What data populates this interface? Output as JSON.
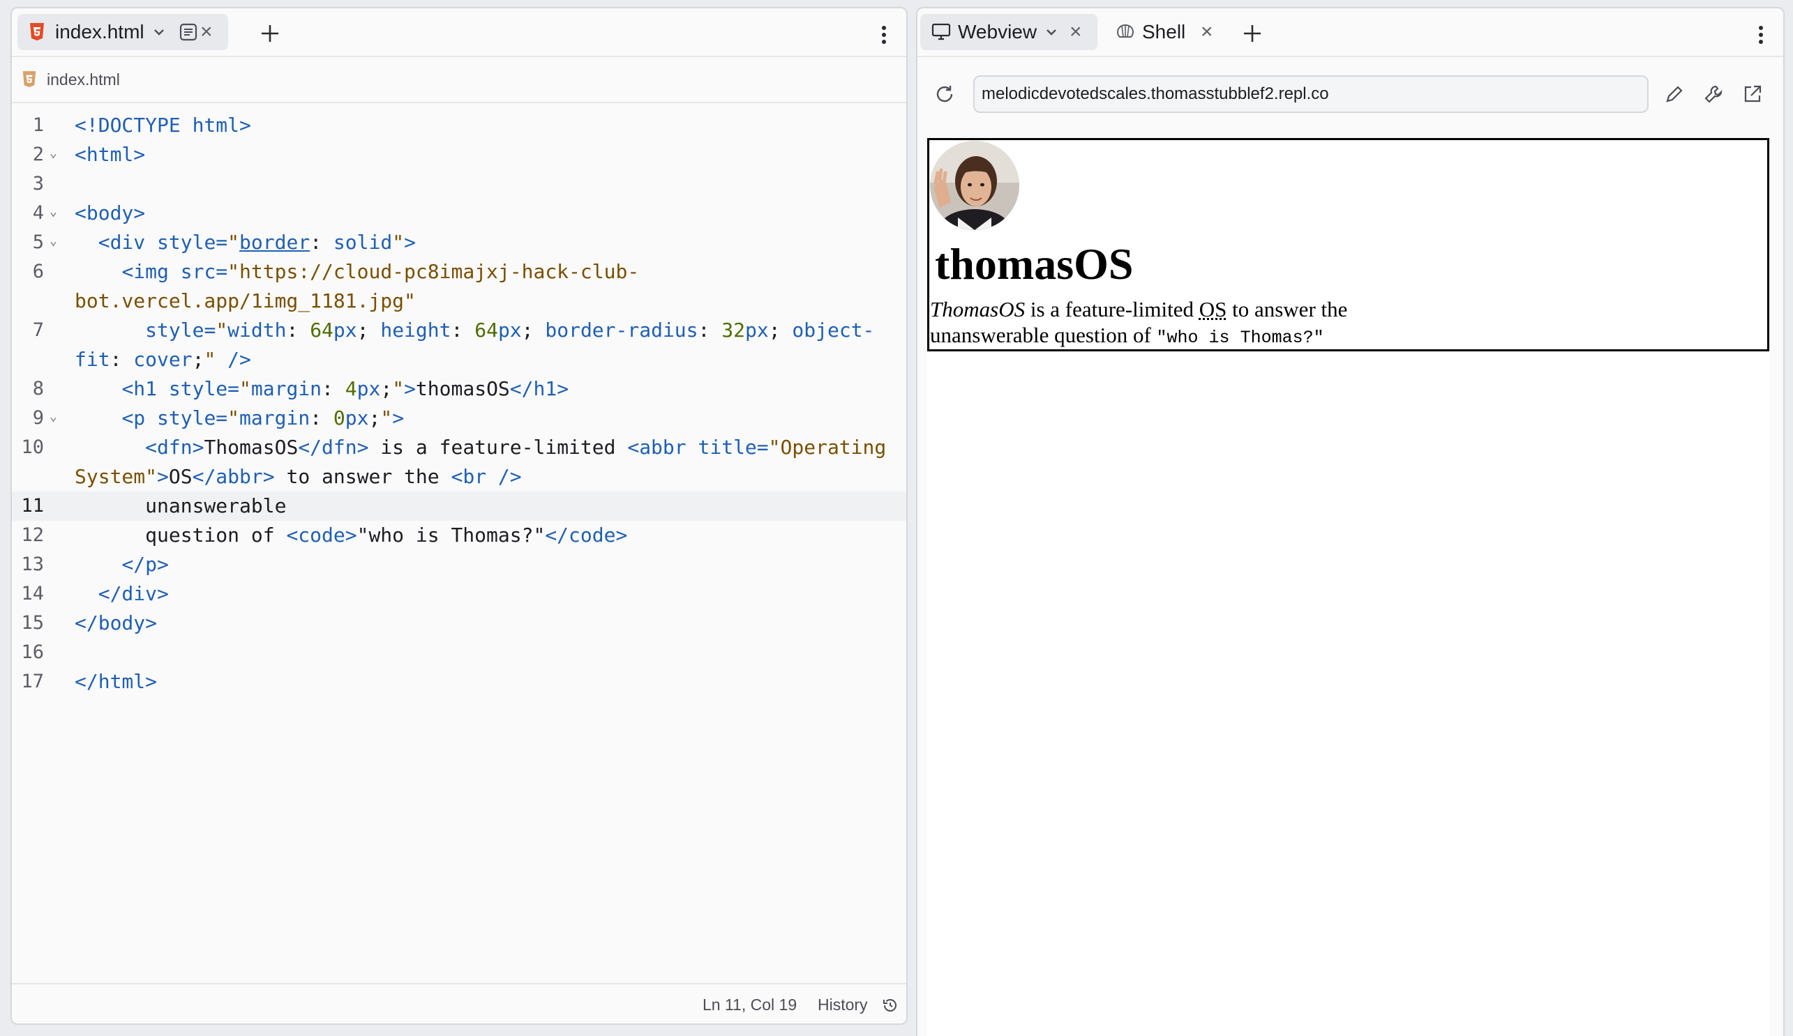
{
  "editor": {
    "tab_label": "index.html",
    "breadcrumb": "index.html",
    "lines": [
      {
        "num": "1",
        "fold": ""
      },
      {
        "num": "2",
        "fold": "⌄"
      },
      {
        "num": "3",
        "fold": ""
      },
      {
        "num": "4",
        "fold": "⌄"
      },
      {
        "num": "5",
        "fold": "⌄"
      },
      {
        "num": "6",
        "fold": ""
      },
      {
        "num": "",
        "fold": ""
      },
      {
        "num": "7",
        "fold": ""
      },
      {
        "num": "",
        "fold": ""
      },
      {
        "num": "8",
        "fold": ""
      },
      {
        "num": "9",
        "fold": "⌄"
      },
      {
        "num": "10",
        "fold": ""
      },
      {
        "num": "",
        "fold": ""
      },
      {
        "num": "11",
        "fold": ""
      },
      {
        "num": "12",
        "fold": ""
      },
      {
        "num": "13",
        "fold": ""
      },
      {
        "num": "14",
        "fold": ""
      },
      {
        "num": "15",
        "fold": ""
      },
      {
        "num": "16",
        "fold": ""
      },
      {
        "num": "17",
        "fold": ""
      }
    ],
    "current_line": "11",
    "code": [
      [
        {
          "t": "tag",
          "s": "<!DOCTYPE html>"
        }
      ],
      [
        {
          "t": "tag",
          "s": "<html>"
        }
      ],
      [],
      [
        {
          "t": "tag",
          "s": "<body>"
        }
      ],
      [
        {
          "t": "plain",
          "s": "  "
        },
        {
          "t": "tag",
          "s": "<div "
        },
        {
          "t": "attr",
          "s": "style="
        },
        {
          "t": "str",
          "s": "\""
        },
        {
          "t": "attr u",
          "s": "border"
        },
        {
          "t": "plain",
          "s": ": "
        },
        {
          "t": "attr",
          "s": "solid"
        },
        {
          "t": "str",
          "s": "\""
        },
        {
          "t": "tag",
          "s": ">"
        }
      ],
      [
        {
          "t": "plain",
          "s": "    "
        },
        {
          "t": "tag",
          "s": "<img "
        },
        {
          "t": "attr",
          "s": "src="
        },
        {
          "t": "str",
          "s": "\"https://cloud-pc8imajxj-hack-club-"
        }
      ],
      [
        {
          "t": "str",
          "s": "bot.vercel.app/1img_1181.jpg\""
        }
      ],
      [
        {
          "t": "plain",
          "s": "      "
        },
        {
          "t": "attr",
          "s": "style="
        },
        {
          "t": "str",
          "s": "\""
        },
        {
          "t": "attr",
          "s": "width"
        },
        {
          "t": "plain",
          "s": ": "
        },
        {
          "t": "num",
          "s": "64"
        },
        {
          "t": "attr",
          "s": "px"
        },
        {
          "t": "plain",
          "s": "; "
        },
        {
          "t": "attr",
          "s": "height"
        },
        {
          "t": "plain",
          "s": ": "
        },
        {
          "t": "num",
          "s": "64"
        },
        {
          "t": "attr",
          "s": "px"
        },
        {
          "t": "plain",
          "s": "; "
        },
        {
          "t": "attr",
          "s": "border-radius"
        },
        {
          "t": "plain",
          "s": ": "
        },
        {
          "t": "num",
          "s": "32"
        },
        {
          "t": "attr",
          "s": "px"
        },
        {
          "t": "plain",
          "s": "; "
        },
        {
          "t": "attr",
          "s": "object-"
        }
      ],
      [
        {
          "t": "attr",
          "s": "fit"
        },
        {
          "t": "plain",
          "s": ": "
        },
        {
          "t": "attr",
          "s": "cover"
        },
        {
          "t": "plain",
          "s": ";"
        },
        {
          "t": "str",
          "s": "\""
        },
        {
          "t": "tag",
          "s": " />"
        }
      ],
      [
        {
          "t": "plain",
          "s": "    "
        },
        {
          "t": "tag",
          "s": "<h1 "
        },
        {
          "t": "attr",
          "s": "style="
        },
        {
          "t": "str",
          "s": "\""
        },
        {
          "t": "attr",
          "s": "margin"
        },
        {
          "t": "plain",
          "s": ": "
        },
        {
          "t": "num",
          "s": "4"
        },
        {
          "t": "attr",
          "s": "px"
        },
        {
          "t": "plain",
          "s": ";"
        },
        {
          "t": "str",
          "s": "\""
        },
        {
          "t": "tag",
          "s": ">"
        },
        {
          "t": "plain",
          "s": "thomasOS"
        },
        {
          "t": "tag",
          "s": "</h1>"
        }
      ],
      [
        {
          "t": "plain",
          "s": "    "
        },
        {
          "t": "tag",
          "s": "<p "
        },
        {
          "t": "attr",
          "s": "style="
        },
        {
          "t": "str",
          "s": "\""
        },
        {
          "t": "attr",
          "s": "margin"
        },
        {
          "t": "plain",
          "s": ": "
        },
        {
          "t": "num",
          "s": "0"
        },
        {
          "t": "attr",
          "s": "px"
        },
        {
          "t": "plain",
          "s": ";"
        },
        {
          "t": "str",
          "s": "\""
        },
        {
          "t": "tag",
          "s": ">"
        }
      ],
      [
        {
          "t": "plain",
          "s": "      "
        },
        {
          "t": "tag",
          "s": "<dfn>"
        },
        {
          "t": "plain",
          "s": "ThomasOS"
        },
        {
          "t": "tag",
          "s": "</dfn>"
        },
        {
          "t": "plain",
          "s": " is a feature-limited "
        },
        {
          "t": "tag",
          "s": "<abbr "
        },
        {
          "t": "attr",
          "s": "title="
        },
        {
          "t": "str",
          "s": "\"Operating"
        }
      ],
      [
        {
          "t": "str",
          "s": "System\""
        },
        {
          "t": "tag",
          "s": ">"
        },
        {
          "t": "plain",
          "s": "OS"
        },
        {
          "t": "tag",
          "s": "</abbr>"
        },
        {
          "t": "plain",
          "s": " to answer the "
        },
        {
          "t": "tag",
          "s": "<br />"
        }
      ],
      [
        {
          "t": "plain",
          "s": "      unanswerable"
        }
      ],
      [
        {
          "t": "plain",
          "s": "      question of "
        },
        {
          "t": "tag",
          "s": "<code>"
        },
        {
          "t": "plain",
          "s": "\"who is Thomas?\""
        },
        {
          "t": "tag",
          "s": "</code>"
        }
      ],
      [
        {
          "t": "plain",
          "s": "    "
        },
        {
          "t": "tag",
          "s": "</p>"
        }
      ],
      [
        {
          "t": "plain",
          "s": "  "
        },
        {
          "t": "tag",
          "s": "</div>"
        }
      ],
      [
        {
          "t": "tag",
          "s": "</body>"
        }
      ],
      [],
      [
        {
          "t": "tag",
          "s": "</html>"
        }
      ]
    ],
    "status": {
      "position": "Ln 11, Col 19",
      "history_label": "History"
    }
  },
  "preview": {
    "tabs": [
      {
        "label": "Webview"
      },
      {
        "label": "Shell"
      }
    ],
    "url": "melodicdevotedscales.thomasstubblef2.repl.co",
    "site": {
      "title": "thomasOS",
      "dfn": "ThomasOS",
      "text1": " is a feature-limited ",
      "abbr": "OS",
      "abbr_title": "Operating System",
      "text2": " to answer the",
      "text3": "unanswerable question of ",
      "code": "\"who is Thomas?\""
    }
  }
}
